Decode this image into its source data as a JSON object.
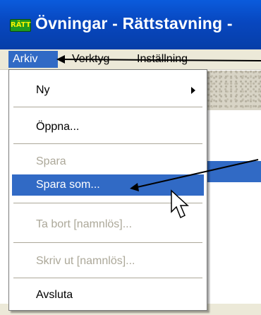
{
  "window": {
    "title": "Övningar - Rättstavning -",
    "icon_label": "RÄTT"
  },
  "menubar": {
    "items": [
      "Arkiv",
      "Verktyg",
      "Inställning"
    ]
  },
  "file_menu": {
    "items": [
      {
        "label": "Ny",
        "submenu": true
      },
      {
        "label": "Öppna..."
      },
      {
        "label": "Spara",
        "disabled": true
      },
      {
        "label": "Spara som...",
        "selected": true
      },
      {
        "label": "Ta bort [namnlös]...",
        "disabled": true
      },
      {
        "label": "Skriv ut [namnlös]...",
        "disabled": true
      },
      {
        "label": "Avsluta"
      }
    ]
  },
  "colors": {
    "titlebar": "#0847bf",
    "selection": "#316ac5",
    "disabled_text": "#aca899",
    "menubar_bg": "#ece9d8"
  }
}
